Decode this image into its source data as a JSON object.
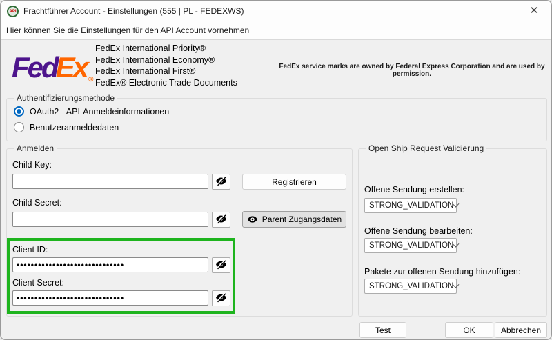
{
  "window": {
    "title": "Frachtführer Account - Einstellungen (555 | PL - FEDEXWS)",
    "subtitle": "Hier können Sie die Einstellungen für den API Account vornehmen",
    "app_icon_text": "API",
    "close_glyph": "✕"
  },
  "fedex": {
    "logo": {
      "part1": "Fed",
      "part2": "Ex",
      "registered_mark": "®",
      "purple": "#4D148C",
      "orange": "#FF6600"
    },
    "services": [
      "FedEx International Priority®",
      "FedEx International Economy®",
      "FedEx International First®",
      "FedEx® Electronic Trade Documents"
    ],
    "trademark_notice": "FedEx service marks are owned by Federal Express Corporation and are used by permission."
  },
  "auth": {
    "group_label": "Authentifizierungsmethode",
    "options": [
      {
        "label": "OAuth2 - API-Anmeldeinformationen",
        "selected": true
      },
      {
        "label": "Benutzeranmeldedaten",
        "selected": false
      }
    ]
  },
  "login": {
    "group_label": "Anmelden",
    "child_key_label": "Child Key:",
    "child_key_value": "",
    "child_secret_label": "Child Secret:",
    "child_secret_value": "",
    "register_button": "Registrieren",
    "parent_button": "Parent Zugangsdaten",
    "client_id_label": "Client ID:",
    "client_id_value": "••••••••••••••••••••••••••••••",
    "client_secret_label": "Client Secret:",
    "client_secret_value": "••••••••••••••••••••••••••••••",
    "highlight_color": "#1eb41e"
  },
  "openship": {
    "group_label": "Open Ship Request Validierung",
    "fields": [
      {
        "label": "Offene Sendung erstellen:",
        "value": "STRONG_VALIDATION"
      },
      {
        "label": "Offene Sendung bearbeiten:",
        "value": "STRONG_VALIDATION"
      },
      {
        "label": "Pakete zur offenen Sendung hinzufügen:",
        "value": "STRONG_VALIDATION"
      }
    ]
  },
  "footer": {
    "test_button": "Test",
    "ok_button": "OK",
    "cancel_button": "Abbrechen"
  },
  "colors": {
    "radio_selected": "#0067c0",
    "fedex_purple": "#4D148C",
    "fedex_orange": "#FF6600"
  }
}
